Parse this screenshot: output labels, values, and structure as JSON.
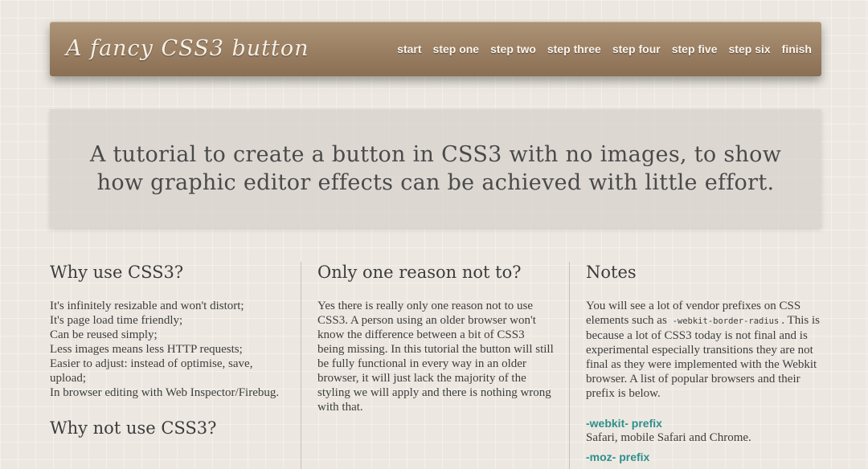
{
  "header": {
    "logo": "A fancy CSS3 button",
    "nav": [
      "start",
      "step one",
      "step two",
      "step three",
      "step four",
      "step five",
      "step six",
      "finish"
    ]
  },
  "hero": {
    "text": "A tutorial to create a button in CSS3 with no images, to show how graphic editor effects can be achieved with little effort."
  },
  "columns": {
    "why": {
      "title": "Why use CSS3?",
      "lines": [
        "It's infinitely resizable and won't distort;",
        "It's page load time friendly;",
        "Can be reused simply;",
        "Less images means less HTTP requests;",
        "Easier to adjust: instead of optimise, save, upload;",
        "In browser editing with Web Inspector/Firebug."
      ],
      "title2": "Why not use CSS3?"
    },
    "reason": {
      "title": "Only one reason not to?",
      "text": "Yes there is really only one reason not to use CSS3. A person using an older browser won't know the difference between a bit of CSS3 being missing. In this tutorial the button will still be fully functional in every way in an older browser, it will just lack the majority of the styling we will apply and there is nothing wrong with that."
    },
    "notes": {
      "title": "Notes",
      "text_before": "You will see a lot of vendor prefixes on CSS elements such as",
      "code": "-webkit-border-radius",
      "text_after": ". This is because a lot of CSS3 today is not final and is experimental especially transitions they are not final as they were implemented with the Webkit browser. A list of popular browsers and their prefix is below.",
      "prefixes": [
        {
          "label": "-webkit- prefix",
          "desc": "Safari, mobile Safari and Chrome."
        },
        {
          "label": "-moz- prefix",
          "desc": ""
        }
      ]
    }
  },
  "colors": {
    "header_brown": "#9d8266",
    "link_teal": "#2f8e8c",
    "page_bg": "#ece8e1"
  }
}
